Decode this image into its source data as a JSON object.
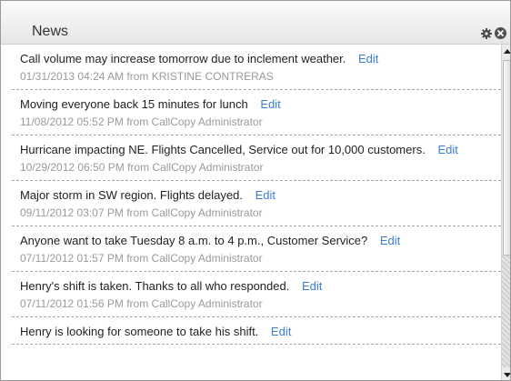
{
  "widget": {
    "title": "News",
    "icons": [
      "gear-icon",
      "close-icon"
    ]
  },
  "news": {
    "edit_label": "Edit",
    "items": [
      {
        "message": "Call volume may increase tomorrow due to inclement weather.",
        "meta": "01/31/2013 04:24 AM from KRISTINE CONTRERAS"
      },
      {
        "message": "Moving everyone back 15 minutes for lunch",
        "meta": "11/08/2012 05:52 PM from CallCopy Administrator"
      },
      {
        "message": "Hurricane impacting NE. Flights Cancelled, Service out for 10,000 customers.",
        "meta": "10/29/2012 06:50 PM from CallCopy Administrator"
      },
      {
        "message": "Major storm in SW region. Flights delayed.",
        "meta": "09/11/2012 03:07 PM from CallCopy Administrator"
      },
      {
        "message": "Anyone want to take Tuesday 8 a.m. to 4 p.m., Customer Service?",
        "meta": "07/11/2012 01:57 PM from CallCopy Administrator"
      },
      {
        "message": "Henry's shift is taken. Thanks to all who responded.",
        "meta": "07/11/2012 01:56 PM from CallCopy Administrator"
      },
      {
        "message": "Henry is looking for someone to take his shift.",
        "meta": ""
      }
    ]
  },
  "colors": {
    "link": "#3a7fd5",
    "meta_text": "#9a9a9a",
    "header_bg": "#eeeeee"
  }
}
